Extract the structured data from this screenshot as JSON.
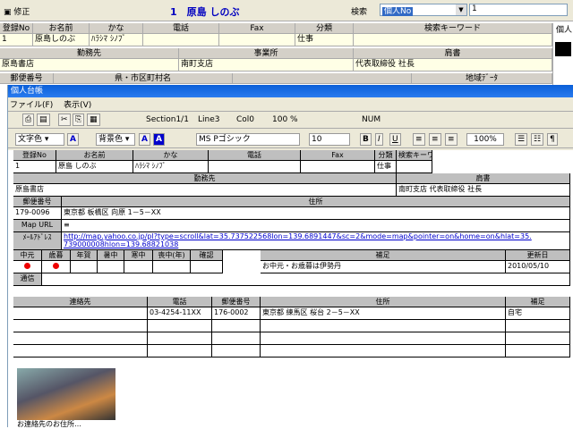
{
  "main": {
    "title_prefix": "修正",
    "record_no": "1",
    "record_name": "原島 しのぶ",
    "search_label": "検索",
    "search_field": "個人No",
    "search_value": "1",
    "grid1_headers": [
      "登録No",
      "お名前",
      "かな",
      "電話",
      "Fax",
      "分類",
      "検索キーワード"
    ],
    "grid1_row": [
      "1",
      "原島しのぶ",
      "ﾊﾗｼﾏ ｼﾉﾌﾞ",
      "",
      "",
      "仕事",
      ""
    ],
    "grid2_headers": [
      "勤務先",
      "事業所",
      "肩書"
    ],
    "grid2_row": [
      "原島書店",
      "南町支店",
      "代表取締役 社長"
    ],
    "grid3_headers": [
      "郵便番号",
      "県・市区町村名",
      "",
      "地域ﾃﾞｰﾀ"
    ],
    "side_label": "個人"
  },
  "win2": {
    "title": "個人台帳",
    "menu": [
      "ファイル(F)",
      "表示(V)"
    ],
    "status": [
      "Section1/1",
      "Line3",
      "Col0",
      "100 %",
      "NUM"
    ],
    "format": {
      "text_color": "文字色",
      "bg_color": "背景色",
      "font": "MS Pゴシック",
      "size": "10",
      "zoom": "100%"
    },
    "t1_headers": [
      "登録No",
      "お名前",
      "かな",
      "電話",
      "Fax",
      "分類",
      "検索キーワード"
    ],
    "t1_row": [
      "1",
      "原島 しのぶ",
      "ﾊﾗｼﾏ ｼﾉﾌﾞ",
      "",
      "",
      "仕事",
      ""
    ],
    "t2_headers": [
      "勤務先",
      "肩書"
    ],
    "t2_row": [
      "原島書店",
      "南町支店 代表取締役 社長"
    ],
    "zip_label": "郵便番号",
    "addr_label": "住所",
    "zip": "179-0096",
    "addr": "東京都 板橋区 向原 1－5－XX",
    "map_label": "Map URL",
    "map_value": "≡",
    "mail_label": "ﾒｰﾙｱﾄﾞﾚｽ",
    "url1": "http://map.yahoo.co.jp/pl?type=scroll&lat=35.737522568lon=139.6891447&sc=2&mode=map&pointer=on&home=on&hlat=35.",
    "url2": "739000008hlon=139.68821038",
    "t3_headers": [
      "中元",
      "歳暮",
      "年賀",
      "暑中",
      "寒中",
      "喪中(年)",
      "確認",
      "補足",
      "更新日"
    ],
    "t3_note": "お中元・お歳暮は伊勢丹",
    "t3_date": "2010/05/10",
    "tsushin_label": "通信",
    "t4_headers": [
      "連絡先",
      "電話",
      "郵便番号",
      "住所",
      "補足"
    ],
    "t4_row1": [
      "",
      "03-4254-11XX",
      "176-0002",
      "東京都 練馬区 桜台 2－5－XX",
      "自宅"
    ],
    "caption": "お連絡先のお住所…"
  }
}
